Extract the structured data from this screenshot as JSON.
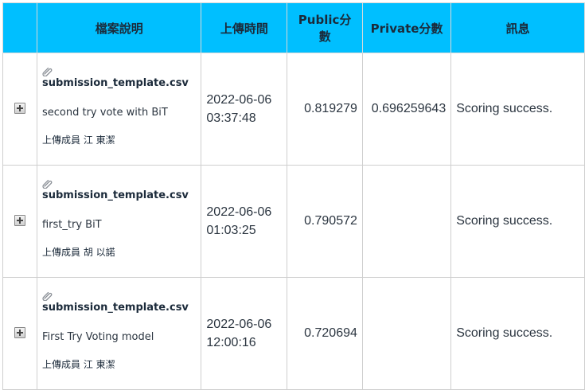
{
  "columns": {
    "expand": "",
    "file": "檔案說明",
    "time": "上傳時間",
    "public_line1": "Public分",
    "public_line2": "數",
    "private": "Private分數",
    "message": "訊息"
  },
  "rows": [
    {
      "filename": "submission_template.csv",
      "description": "second try vote with BiT",
      "uploader_label": "上傳成員",
      "uploader_name": "江 東潔",
      "date": "2022-06-06",
      "time": "03:37:48",
      "public_score": "0.819279",
      "private_score": "0.696259643",
      "message": "Scoring success."
    },
    {
      "filename": "submission_template.csv",
      "description": "first_try BiT",
      "uploader_label": "上傳成員",
      "uploader_name": "胡 以諾",
      "date": "2022-06-06",
      "time": "01:03:25",
      "public_score": "0.790572",
      "private_score": "",
      "message": "Scoring success."
    },
    {
      "filename": "submission_template.csv",
      "description": "First Try Voting model",
      "uploader_label": "上傳成員",
      "uploader_name": "江 東潔",
      "date": "2022-06-06",
      "time": "12:00:16",
      "public_score": "0.720694",
      "private_score": "",
      "message": "Scoring success."
    }
  ],
  "icons": {
    "attachment": "paperclip-icon",
    "expand": "expand-plus-icon"
  },
  "colors": {
    "header_bg": "#00bfff",
    "border": "#cfcfcf"
  }
}
